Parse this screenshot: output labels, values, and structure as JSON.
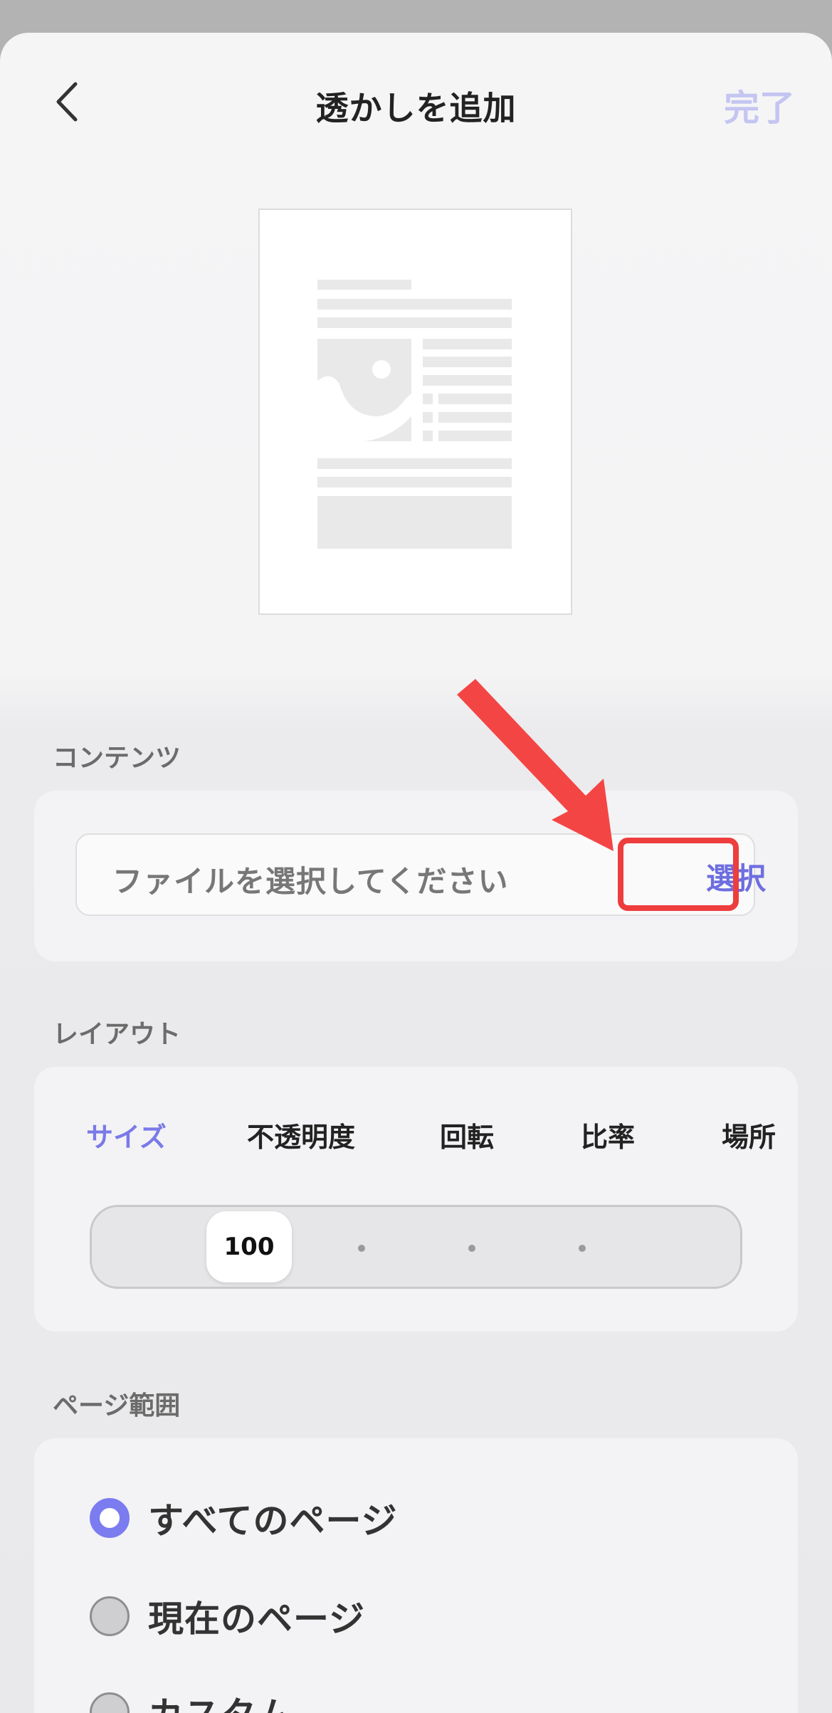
{
  "header": {
    "title": "透かしを追加",
    "done_label": "完了"
  },
  "content_section": {
    "label": "コンテンツ",
    "file_placeholder": "ファイルを選択してください",
    "select_label": "選択"
  },
  "layout_section": {
    "label": "レイアウト",
    "tabs": [
      {
        "label": "サイズ",
        "active": true
      },
      {
        "label": "不透明度",
        "active": false
      },
      {
        "label": "回転",
        "active": false
      },
      {
        "label": "比率",
        "active": false
      },
      {
        "label": "場所",
        "active": false
      }
    ],
    "slider": {
      "value_label": "100"
    }
  },
  "page_range_section": {
    "label": "ページ範囲",
    "options": [
      {
        "label": "すべてのページ",
        "selected": true
      },
      {
        "label": "現在のページ",
        "selected": false
      },
      {
        "label": "カスタム",
        "selected": false
      }
    ]
  },
  "colors": {
    "accent": "#7a7ae8",
    "highlight": "#ee3d3d",
    "done_disabled": "#c5c5f2"
  },
  "icons": {
    "back": "chevron-left-icon",
    "annotation": "red-arrow",
    "preview": "document-placeholder"
  }
}
